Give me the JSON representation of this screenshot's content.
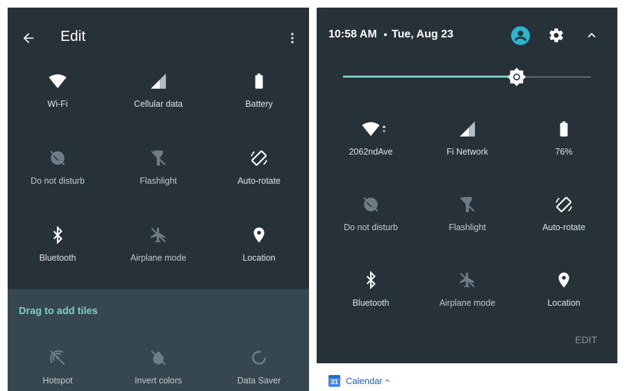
{
  "left_panel": {
    "header": {
      "title": "Edit"
    },
    "tiles": [
      {
        "label": "Wi-Fi",
        "icon": "wifi-icon"
      },
      {
        "label": "Cellular data",
        "icon": "cellular-icon"
      },
      {
        "label": "Battery",
        "icon": "battery-icon"
      },
      {
        "label": "Do not disturb",
        "icon": "do-not-disturb-icon"
      },
      {
        "label": "Flashlight",
        "icon": "flashlight-icon"
      },
      {
        "label": "Auto-rotate",
        "icon": "auto-rotate-icon"
      },
      {
        "label": "Bluetooth",
        "icon": "bluetooth-icon"
      },
      {
        "label": "Airplane mode",
        "icon": "airplane-icon"
      },
      {
        "label": "Location",
        "icon": "location-icon"
      }
    ],
    "add_section": {
      "title": "Drag to add tiles",
      "tiles": [
        {
          "label": "Hotspot",
          "icon": "hotspot-icon"
        },
        {
          "label": "Invert colors",
          "icon": "invert-colors-icon"
        },
        {
          "label": "Data Saver",
          "icon": "data-saver-icon"
        }
      ]
    }
  },
  "right_panel": {
    "status": {
      "time": "10:58 AM",
      "date": "Tue, Aug 23"
    },
    "brightness": {
      "level": 0.7
    },
    "tiles": [
      {
        "label": "2062ndAve",
        "icon": "wifi-icon"
      },
      {
        "label": "Fi Network",
        "icon": "cellular-icon"
      },
      {
        "label": "76%",
        "icon": "battery-icon"
      },
      {
        "label": "Do not disturb",
        "icon": "do-not-disturb-icon"
      },
      {
        "label": "Flashlight",
        "icon": "flashlight-icon"
      },
      {
        "label": "Auto-rotate",
        "icon": "auto-rotate-icon"
      },
      {
        "label": "Bluetooth",
        "icon": "bluetooth-icon"
      },
      {
        "label": "Airplane mode",
        "icon": "airplane-icon"
      },
      {
        "label": "Location",
        "icon": "location-icon"
      }
    ],
    "edit_label": "EDIT"
  },
  "bottom": {
    "app_label": "Calendar",
    "calendar_day": "31"
  },
  "colors": {
    "panel": "#263238",
    "add_area": "#37474f",
    "accent": "#80cbc4",
    "avatar": "#29b6d1"
  }
}
